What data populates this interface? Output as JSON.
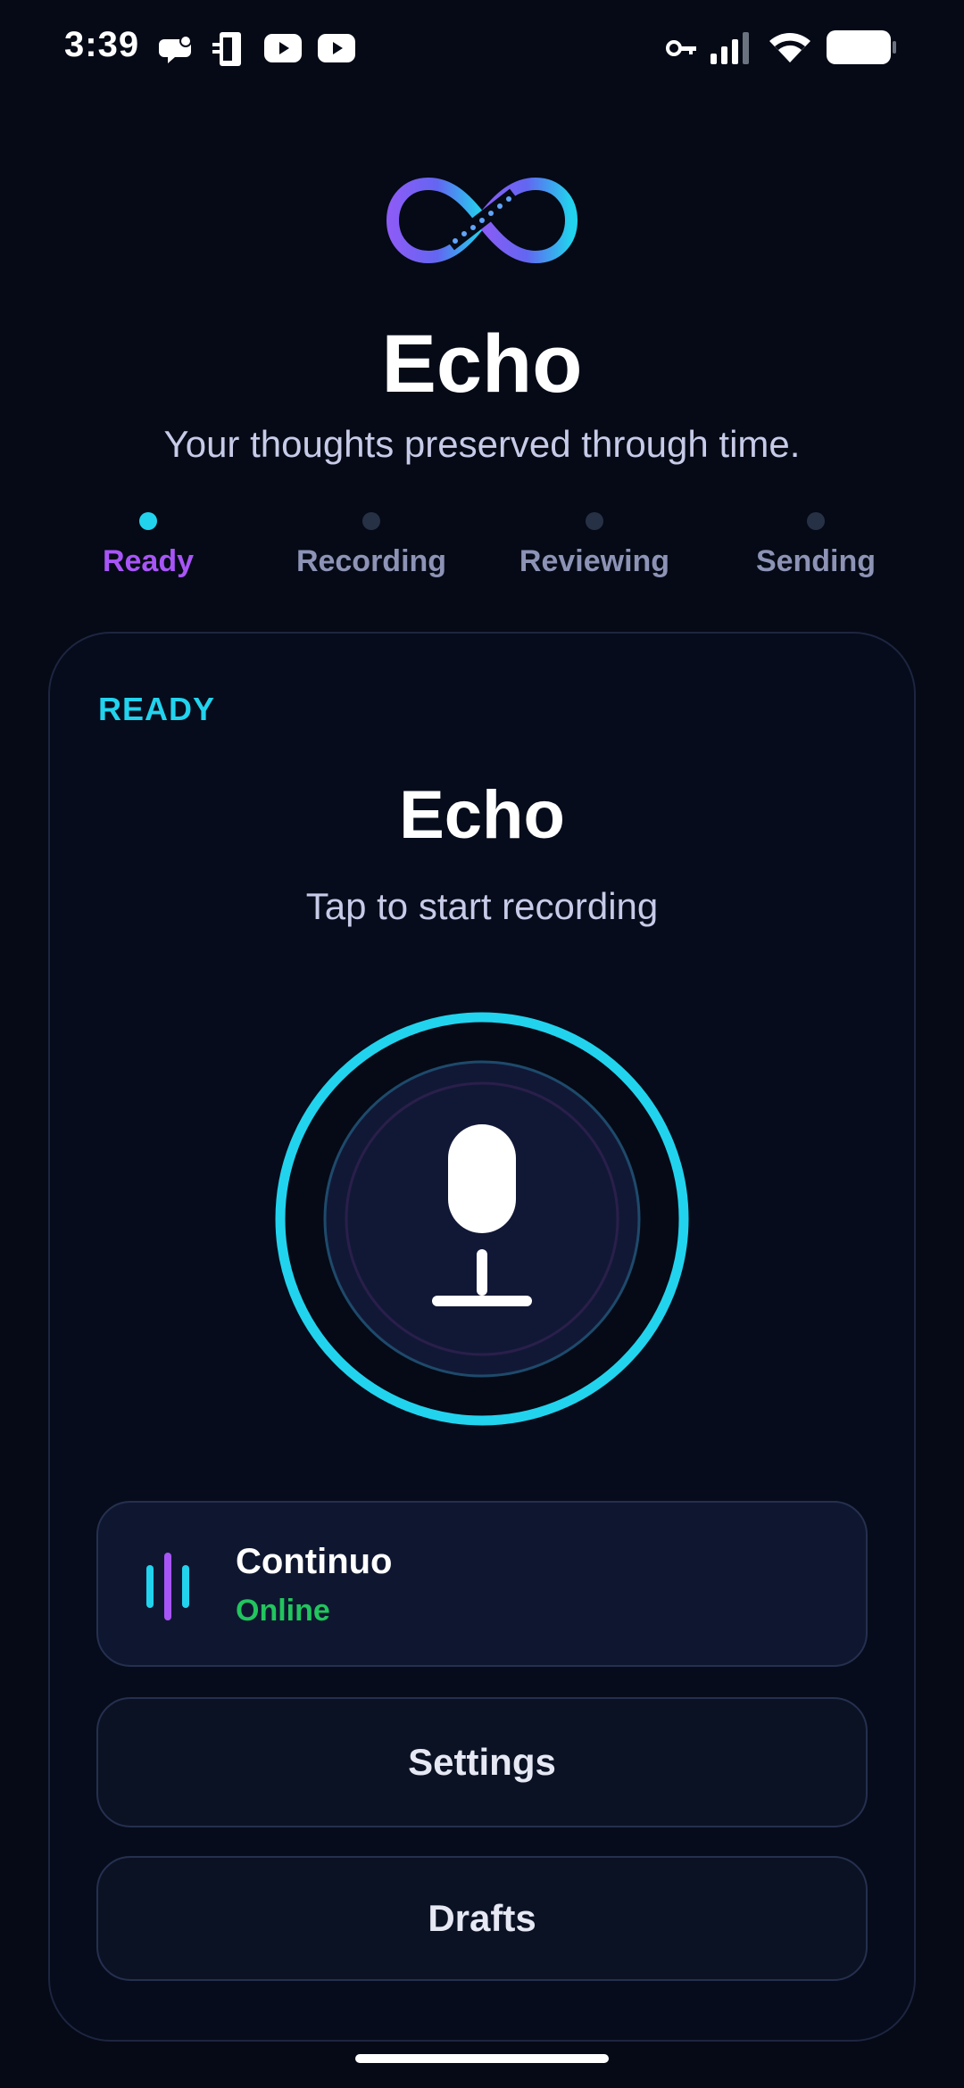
{
  "status_bar": {
    "time": "3:39",
    "icons": [
      "chat-bubble-icon",
      "mobile-data-transfer-icon",
      "youtube-icon",
      "youtube-icon",
      "key-icon",
      "signal-icon",
      "wifi-icon",
      "battery-icon"
    ]
  },
  "header": {
    "logo": "infinity-icon",
    "title": "Echo",
    "tagline": "Your thoughts preserved through time."
  },
  "stepper": {
    "steps": [
      {
        "label": "Ready",
        "active": true
      },
      {
        "label": "Recording",
        "active": false
      },
      {
        "label": "Reviewing",
        "active": false
      },
      {
        "label": "Sending",
        "active": false
      }
    ]
  },
  "card": {
    "state_tag": "READY",
    "title": "Echo",
    "subtitle": "Tap to start recording",
    "mic_icon": "microphone-icon",
    "service": {
      "name": "Continuo",
      "status": "Online",
      "icon": "audio-bars-icon"
    },
    "buttons": {
      "settings": "Settings",
      "drafts": "Drafts"
    }
  },
  "colors": {
    "background": "#050a16",
    "accent_cyan": "#22d3ee",
    "accent_purple": "#a855f7",
    "online_green": "#22c55e"
  }
}
